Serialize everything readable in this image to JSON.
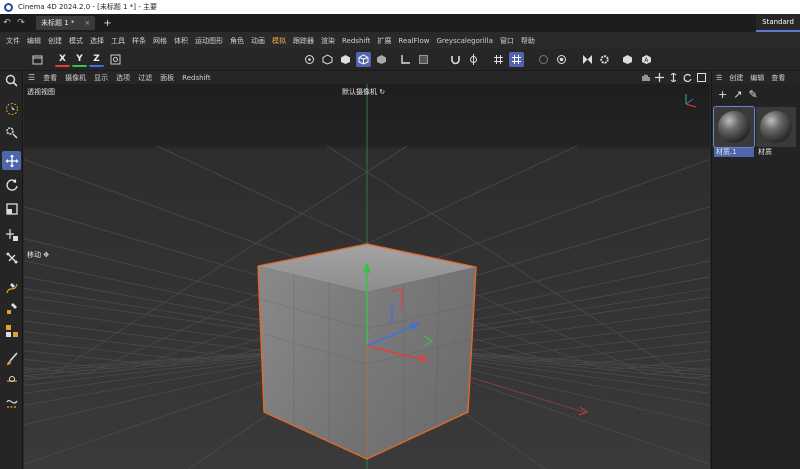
{
  "window": {
    "title": "Cinema 4D 2024.2.0 - [未标题 1 *] - 主要"
  },
  "tabs": {
    "active_label": "未标题 1 *",
    "close": "×",
    "add": "+",
    "layout": "Standard",
    "back": "↶",
    "forward": "↷"
  },
  "menu": [
    "文件",
    "编辑",
    "创建",
    "模式",
    "选择",
    "工具",
    "样条",
    "网格",
    "体积",
    "运动图形",
    "角色",
    "动画",
    "模拟",
    "跟踪器",
    "渲染",
    "Redshift",
    "扩展",
    "RealFlow",
    "Greyscalegorilla",
    "窗口",
    "帮助"
  ],
  "menu_active": "模拟",
  "toolbar": {
    "axis_x": "X",
    "axis_y": "Y",
    "axis_z": "Z"
  },
  "viewport": {
    "menu": [
      "查看",
      "摄像机",
      "显示",
      "选项",
      "过滤",
      "面板",
      "Redshift"
    ],
    "view_name": "透视视图",
    "camera_name": "默认摄像机",
    "tool_hint": "移动"
  },
  "right_panel": {
    "menu": [
      "创建",
      "编辑",
      "查看"
    ],
    "materials": [
      {
        "name": "材质.1",
        "selected": true
      },
      {
        "name": "材质",
        "selected": false
      }
    ]
  },
  "colors": {
    "accent": "#4f66ad",
    "menu_active": "#f0b041",
    "selection_edge": "#e06a2a",
    "axis_x": "#e0403a",
    "axis_y": "#39c04a",
    "axis_z": "#3f6fe0"
  }
}
